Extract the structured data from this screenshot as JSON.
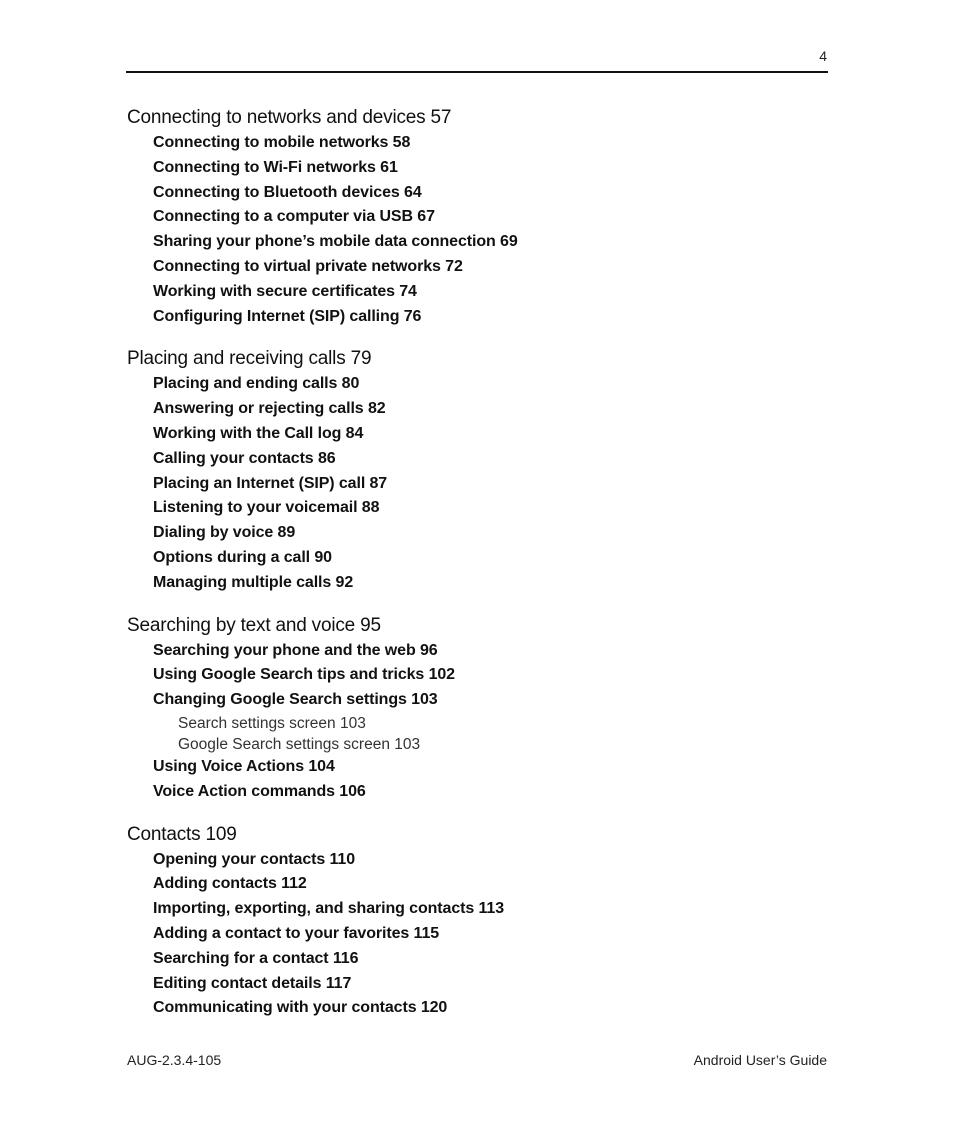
{
  "header": {
    "page_number": "4"
  },
  "toc": {
    "sections": [
      {
        "title": "Connecting to networks and devices 57",
        "entries": [
          {
            "text": "Connecting to mobile networks 58",
            "level": 2
          },
          {
            "text": "Connecting to Wi-Fi networks 61",
            "level": 2
          },
          {
            "text": "Connecting to Bluetooth devices 64",
            "level": 2
          },
          {
            "text": "Connecting to a computer via USB 67",
            "level": 2
          },
          {
            "text": "Sharing your phone’s mobile data connection 69",
            "level": 2
          },
          {
            "text": "Connecting to virtual private networks 72",
            "level": 2
          },
          {
            "text": "Working with secure certificates 74",
            "level": 2
          },
          {
            "text": "Configuring Internet (SIP) calling 76",
            "level": 2
          }
        ]
      },
      {
        "title": "Placing and receiving calls 79",
        "entries": [
          {
            "text": "Placing and ending calls 80",
            "level": 2
          },
          {
            "text": "Answering or rejecting calls 82",
            "level": 2
          },
          {
            "text": "Working with the Call log 84",
            "level": 2
          },
          {
            "text": "Calling your contacts 86",
            "level": 2
          },
          {
            "text": "Placing an Internet (SIP) call 87",
            "level": 2
          },
          {
            "text": "Listening to your voicemail 88",
            "level": 2
          },
          {
            "text": "Dialing by voice 89",
            "level": 2
          },
          {
            "text": "Options during a call 90",
            "level": 2
          },
          {
            "text": "Managing multiple calls 92",
            "level": 2
          }
        ]
      },
      {
        "title": "Searching by text and voice 95",
        "entries": [
          {
            "text": "Searching your phone and the web 96",
            "level": 2
          },
          {
            "text": "Using Google Search tips and tricks 102",
            "level": 2
          },
          {
            "text": "Changing Google Search settings 103",
            "level": 2
          },
          {
            "text": "Search settings screen 103",
            "level": 3
          },
          {
            "text": "Google Search settings screen 103",
            "level": 3
          },
          {
            "text": "Using Voice Actions 104",
            "level": 2
          },
          {
            "text": "Voice Action commands 106",
            "level": 2
          }
        ]
      },
      {
        "title": "Contacts 109",
        "entries": [
          {
            "text": "Opening your contacts 110",
            "level": 2
          },
          {
            "text": "Adding contacts 112",
            "level": 2
          },
          {
            "text": "Importing, exporting, and sharing contacts 113",
            "level": 2
          },
          {
            "text": "Adding a contact to your favorites 115",
            "level": 2
          },
          {
            "text": "Searching for a contact 116",
            "level": 2
          },
          {
            "text": "Editing contact details 117",
            "level": 2
          },
          {
            "text": "Communicating with your contacts 120",
            "level": 2
          }
        ]
      }
    ]
  },
  "footer": {
    "doc_code": "AUG-2.3.4-105",
    "doc_title": "Android User’s Guide"
  }
}
